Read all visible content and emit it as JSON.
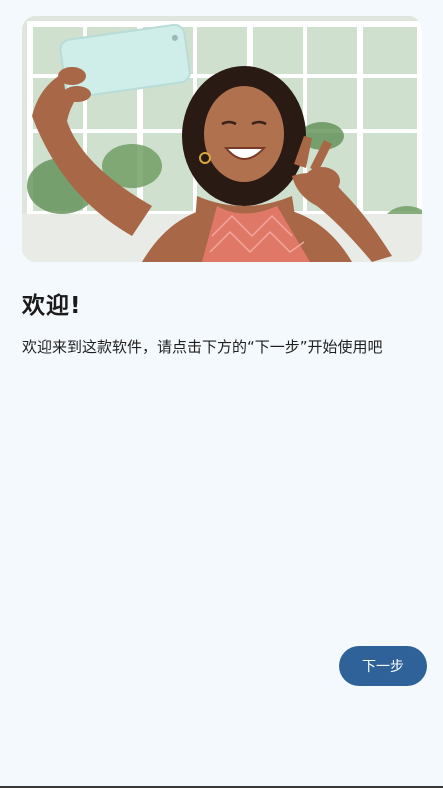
{
  "welcome": {
    "title": "欢迎!",
    "description": "欢迎来到这款软件，请点击下方的“下一步”开始使用吧"
  },
  "actions": {
    "next_label": "下一步"
  },
  "hero_image": {
    "subject": "woman-taking-selfie-photo"
  },
  "colors": {
    "background": "#f4f9fd",
    "primary_button": "#2e6299",
    "title_text": "#1b1b1b"
  }
}
